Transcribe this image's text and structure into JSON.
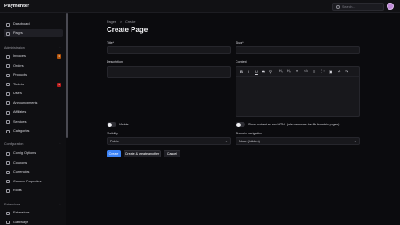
{
  "app": {
    "brand": "Paymenter"
  },
  "search": {
    "placeholder": "Search..."
  },
  "sidebar": {
    "items": [
      {
        "label": "Dashboard"
      },
      {
        "label": "Pages"
      }
    ],
    "administration": {
      "title": "Administration",
      "items": [
        {
          "label": "Invoices",
          "badge": "0"
        },
        {
          "label": "Orders"
        },
        {
          "label": "Products"
        },
        {
          "label": "Tickets",
          "badge": "0"
        },
        {
          "label": "Users"
        },
        {
          "label": "Announcements"
        },
        {
          "label": "Affiliates"
        },
        {
          "label": "Services"
        },
        {
          "label": "Categories"
        }
      ]
    },
    "configuration": {
      "title": "Configuration",
      "items": [
        {
          "label": "Config Options"
        },
        {
          "label": "Coupons"
        },
        {
          "label": "Currencies"
        },
        {
          "label": "Custom Properties"
        },
        {
          "label": "Roles"
        }
      ]
    },
    "extensions": {
      "title": "Extensions",
      "items": [
        {
          "label": "Extensions"
        },
        {
          "label": "Gateways"
        }
      ]
    }
  },
  "breadcrumb": [
    "Pages",
    ">",
    "Create"
  ],
  "page": {
    "title": "Create Page"
  },
  "form": {
    "title_label": "Title*",
    "slug_label": "Slug*",
    "description_label": "Description",
    "content_label": "Content",
    "visible_label": "Visible",
    "raw_html_label": "Show content as raw HTML (also removes the file from trix pages)",
    "visibility_label": "Visibility",
    "visibility_value": "Public",
    "show_in_nav_label": "Show in navigation",
    "show_in_nav_value": "None (hidden)"
  },
  "toolbar_icons": [
    "bold-icon",
    "italic-icon",
    "underline-icon",
    "strike-icon",
    "link-icon",
    "heading1-icon",
    "heading2-icon",
    "quote-icon",
    "code-icon",
    "bullet-list-icon",
    "number-list-icon",
    "image-icon",
    "undo-icon",
    "redo-icon"
  ],
  "toolbar_glyphs": [
    "B",
    "I",
    "U",
    "S",
    "⚲",
    "H₁",
    "H₂",
    "❝",
    "</>",
    "≡",
    "⋮≡",
    "▣",
    "↶",
    "↷"
  ],
  "actions": {
    "create": "Create",
    "create_another": "Create & create another",
    "cancel": "Cancel"
  },
  "colors": {
    "accent": "#3b82f6",
    "badge_amber": "#b45309",
    "badge_red": "#b91c1c"
  }
}
